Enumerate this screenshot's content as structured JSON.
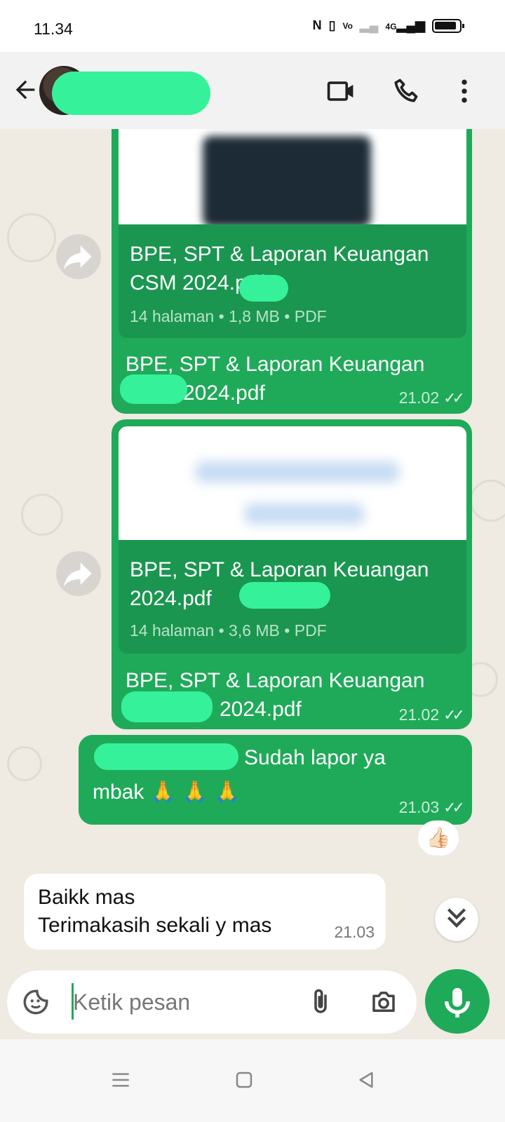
{
  "status": {
    "time": "11.34",
    "icons": [
      "nfc-icon",
      "vibrate-icon",
      "volte-icon",
      "signal-weak-icon",
      "signal-4g-icon",
      "battery-icon"
    ],
    "net_label": "4G"
  },
  "header": {
    "contact_name": "",
    "actions": [
      "video-call-icon",
      "voice-call-icon",
      "more-vert-icon"
    ]
  },
  "messages": [
    {
      "type": "document",
      "doc_title": "BPE, SPT & Laporan Keuangan CSM 2024.pdf",
      "doc_meta": "14 halaman • 1,8 MB • PDF",
      "caption_line1": "BPE, SPT & Laporan Keuangan",
      "caption_line2": "2024.pdf",
      "time": "21.02",
      "status": "read"
    },
    {
      "type": "document",
      "doc_title": "BPE, SPT & Laporan Keuangan 2024.pdf",
      "doc_meta": "14 halaman • 3,6 MB • PDF",
      "caption_line1": "BPE, SPT & Laporan Keuangan",
      "caption_line2": "2024.pdf",
      "time": "21.02",
      "status": "read"
    },
    {
      "type": "text",
      "text_line1": "Sudah lapor ya",
      "text_line2": "mbak 🙏 🙏 🙏",
      "time": "21.03",
      "status": "read",
      "reaction": "👍🏻"
    },
    {
      "type": "text-in",
      "text_line1": "Baikk mas",
      "text_line2": "Terimakasih sekali y mas",
      "time": "21.03"
    }
  ],
  "composer": {
    "placeholder": "Ketik pesan",
    "value": ""
  },
  "colors": {
    "outgoing": "#1faa59",
    "accent": "#1faa59",
    "wallpaper": "#efeae2"
  }
}
